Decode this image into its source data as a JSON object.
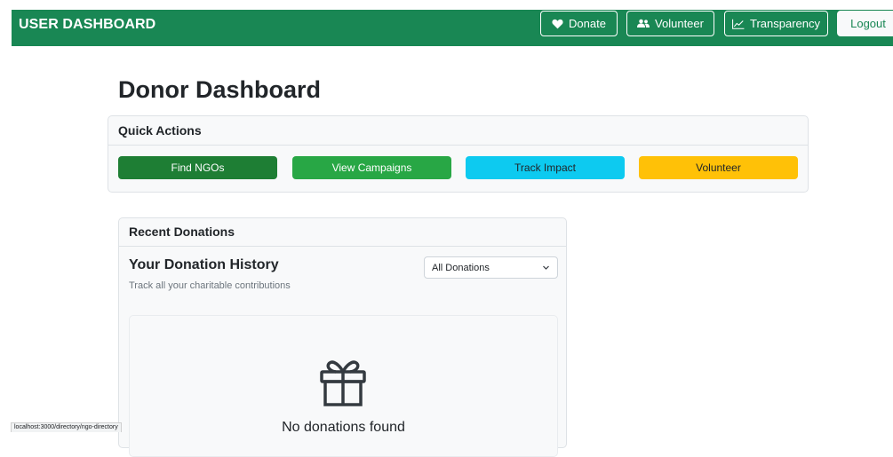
{
  "navbar": {
    "brand": "USER DASHBOARD",
    "links": {
      "donate": "Donate",
      "volunteer": "Volunteer",
      "transparency": "Transparency",
      "logout": "Logout"
    }
  },
  "page": {
    "title": "Donor Dashboard"
  },
  "quick_actions": {
    "header": "Quick Actions",
    "buttons": {
      "find_ngos": "Find NGOs",
      "view_campaigns": "View Campaigns",
      "track_impact": "Track Impact",
      "volunteer": "Volunteer"
    }
  },
  "recent_donations": {
    "header": "Recent Donations",
    "history_title": "Your Donation History",
    "history_subtitle": "Track all your charitable contributions",
    "filter_selected": "All Donations",
    "empty_message": "No donations found"
  },
  "status_bar": {
    "url": "localhost:3000/directory/ngo-directory"
  },
  "colors": {
    "navbar_bg": "#198754",
    "find_ngos": "#1e7e34",
    "view_campaigns": "#28a745",
    "track_impact": "#0dcaf0",
    "volunteer": "#ffc107"
  },
  "icons": {
    "donate": "heart-icon",
    "volunteer": "users-icon",
    "transparency": "chart-line-icon",
    "filter": "chevron-down-icon",
    "empty_state": "gift-icon"
  }
}
